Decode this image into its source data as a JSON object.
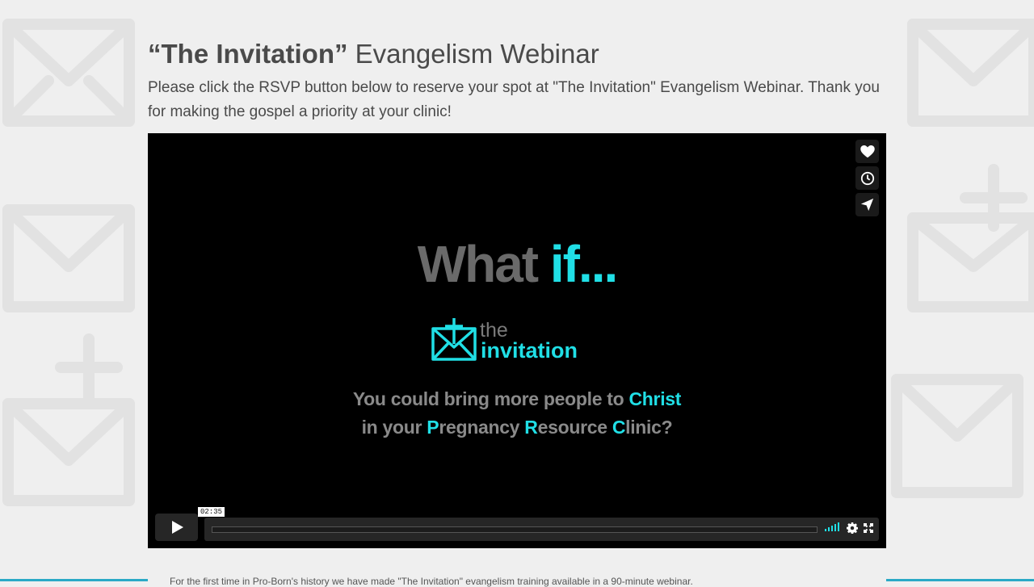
{
  "page": {
    "title_strong": "“The Invitation”",
    "title_rest": " Evangelism Webinar",
    "intro": "Please click the RSVP button below to reserve your spot at \"The Invitation\" Evangelism Webinar. Thank you for making the gospel a priority at your clinic!",
    "footer_text": "For the first time in Pro-Born's history we have made \"The Invitation\" evangelism training available in a 90-minute webinar."
  },
  "video": {
    "headline_grey": "What ",
    "headline_cyan": "if...",
    "logo_the": "the",
    "logo_invitation": "invitation",
    "line1_grey": "You could bring more people to ",
    "line1_cyan": "Christ",
    "line2": [
      {
        "text": "in your ",
        "cyan": false
      },
      {
        "text": "P",
        "cyan": true
      },
      {
        "text": "regnancy ",
        "cyan": false
      },
      {
        "text": "R",
        "cyan": true
      },
      {
        "text": "esource ",
        "cyan": false
      },
      {
        "text": "C",
        "cyan": true
      },
      {
        "text": "linic?",
        "cyan": false
      }
    ],
    "timecode": "02:35",
    "progress": 0,
    "accent_color": "#20dfe6",
    "side_buttons": [
      "heart-icon",
      "clock-icon",
      "send-icon"
    ]
  }
}
